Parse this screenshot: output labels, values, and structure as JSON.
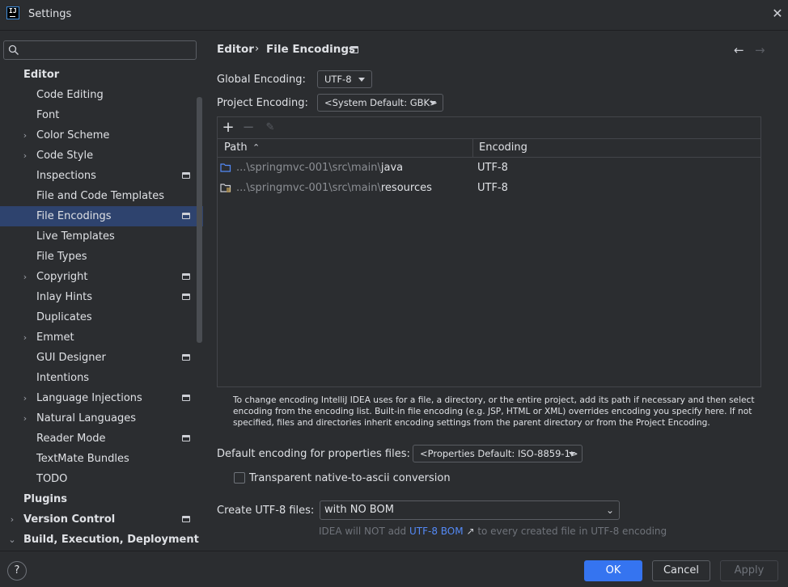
{
  "window": {
    "title": "Settings",
    "logo_text": "IJ"
  },
  "sidebar": {
    "search_placeholder": "",
    "items": [
      {
        "label": "Editor",
        "level": 0,
        "bold": true,
        "chevron": "",
        "proj_icon": false,
        "selected": false
      },
      {
        "label": "Code Editing",
        "level": 1,
        "bold": false,
        "chevron": "",
        "proj_icon": false,
        "selected": false
      },
      {
        "label": "Font",
        "level": 1,
        "bold": false,
        "chevron": "",
        "proj_icon": false,
        "selected": false
      },
      {
        "label": "Color Scheme",
        "level": 1,
        "bold": false,
        "chevron": "›",
        "proj_icon": false,
        "selected": false
      },
      {
        "label": "Code Style",
        "level": 1,
        "bold": false,
        "chevron": "›",
        "proj_icon": false,
        "selected": false
      },
      {
        "label": "Inspections",
        "level": 1,
        "bold": false,
        "chevron": "",
        "proj_icon": true,
        "selected": false
      },
      {
        "label": "File and Code Templates",
        "level": 1,
        "bold": false,
        "chevron": "",
        "proj_icon": false,
        "selected": false
      },
      {
        "label": "File Encodings",
        "level": 1,
        "bold": false,
        "chevron": "",
        "proj_icon": true,
        "selected": true
      },
      {
        "label": "Live Templates",
        "level": 1,
        "bold": false,
        "chevron": "",
        "proj_icon": false,
        "selected": false
      },
      {
        "label": "File Types",
        "level": 1,
        "bold": false,
        "chevron": "",
        "proj_icon": false,
        "selected": false
      },
      {
        "label": "Copyright",
        "level": 1,
        "bold": false,
        "chevron": "›",
        "proj_icon": true,
        "selected": false
      },
      {
        "label": "Inlay Hints",
        "level": 1,
        "bold": false,
        "chevron": "",
        "proj_icon": true,
        "selected": false
      },
      {
        "label": "Duplicates",
        "level": 1,
        "bold": false,
        "chevron": "",
        "proj_icon": false,
        "selected": false
      },
      {
        "label": "Emmet",
        "level": 1,
        "bold": false,
        "chevron": "›",
        "proj_icon": false,
        "selected": false
      },
      {
        "label": "GUI Designer",
        "level": 1,
        "bold": false,
        "chevron": "",
        "proj_icon": true,
        "selected": false
      },
      {
        "label": "Intentions",
        "level": 1,
        "bold": false,
        "chevron": "",
        "proj_icon": false,
        "selected": false
      },
      {
        "label": "Language Injections",
        "level": 1,
        "bold": false,
        "chevron": "›",
        "proj_icon": true,
        "selected": false
      },
      {
        "label": "Natural Languages",
        "level": 1,
        "bold": false,
        "chevron": "›",
        "proj_icon": false,
        "selected": false
      },
      {
        "label": "Reader Mode",
        "level": 1,
        "bold": false,
        "chevron": "",
        "proj_icon": true,
        "selected": false
      },
      {
        "label": "TextMate Bundles",
        "level": 1,
        "bold": false,
        "chevron": "",
        "proj_icon": false,
        "selected": false
      },
      {
        "label": "TODO",
        "level": 1,
        "bold": false,
        "chevron": "",
        "proj_icon": false,
        "selected": false
      },
      {
        "label": "Plugins",
        "level": 0,
        "bold": true,
        "chevron": "",
        "proj_icon": false,
        "selected": false
      },
      {
        "label": "Version Control",
        "level": 0,
        "bold": true,
        "chevron": "›",
        "proj_icon": true,
        "selected": false
      },
      {
        "label": "Build, Execution, Deployment",
        "level": 0,
        "bold": true,
        "chevron": "⌄",
        "proj_icon": false,
        "selected": false
      }
    ]
  },
  "breadcrumb": {
    "parent": "Editor",
    "separator": "›",
    "current": "File Encodings"
  },
  "nav": {
    "back": "←",
    "forward": "→"
  },
  "global_encoding": {
    "label": "Global Encoding:",
    "value": "UTF-8"
  },
  "project_encoding": {
    "label": "Project Encoding:",
    "value": "<System Default: GBK>"
  },
  "table": {
    "toolbar": {
      "add": "+",
      "remove": "−",
      "edit": "✎"
    },
    "columns": {
      "path": "Path",
      "sort_indicator": "⌃",
      "encoding": "Encoding"
    },
    "rows": [
      {
        "path_prefix": "...\\springmvc-001\\src\\main\\",
        "path_name": "java",
        "encoding": "UTF-8",
        "folder_icon": "source-folder-icon"
      },
      {
        "path_prefix": "...\\springmvc-001\\src\\main\\",
        "path_name": "resources",
        "encoding": "UTF-8",
        "folder_icon": "resources-folder-icon"
      }
    ]
  },
  "info_text": "To change encoding IntelliJ IDEA uses for a file, a directory, or the entire project, add its path if necessary and then select encoding from the encoding list. Built-in file encoding (e.g. JSP, HTML or XML) overrides encoding you specify here. If not specified, files and directories inherit encoding settings from the parent directory or from the Project Encoding.",
  "properties_encoding": {
    "label": "Default encoding for properties files:",
    "value": "<Properties Default: ISO-8859-1>"
  },
  "native_to_ascii": {
    "label": "Transparent native-to-ascii conversion",
    "checked": false
  },
  "create_utf8": {
    "label": "Create UTF-8 files:",
    "value": "with NO BOM",
    "hint_before": "IDEA will NOT add ",
    "hint_link": "UTF-8 BOM",
    "hint_link_arrow": "↗",
    "hint_after": " to every created file in UTF-8 encoding"
  },
  "footer": {
    "help": "?",
    "ok": "OK",
    "cancel": "Cancel",
    "apply": "Apply"
  },
  "colors": {
    "background": "#2b2d30",
    "selection": "#2e436e",
    "accent": "#3574f0",
    "link": "#548af7",
    "folder_blue": "#548af7",
    "resources_yellow": "#d6ae58"
  }
}
